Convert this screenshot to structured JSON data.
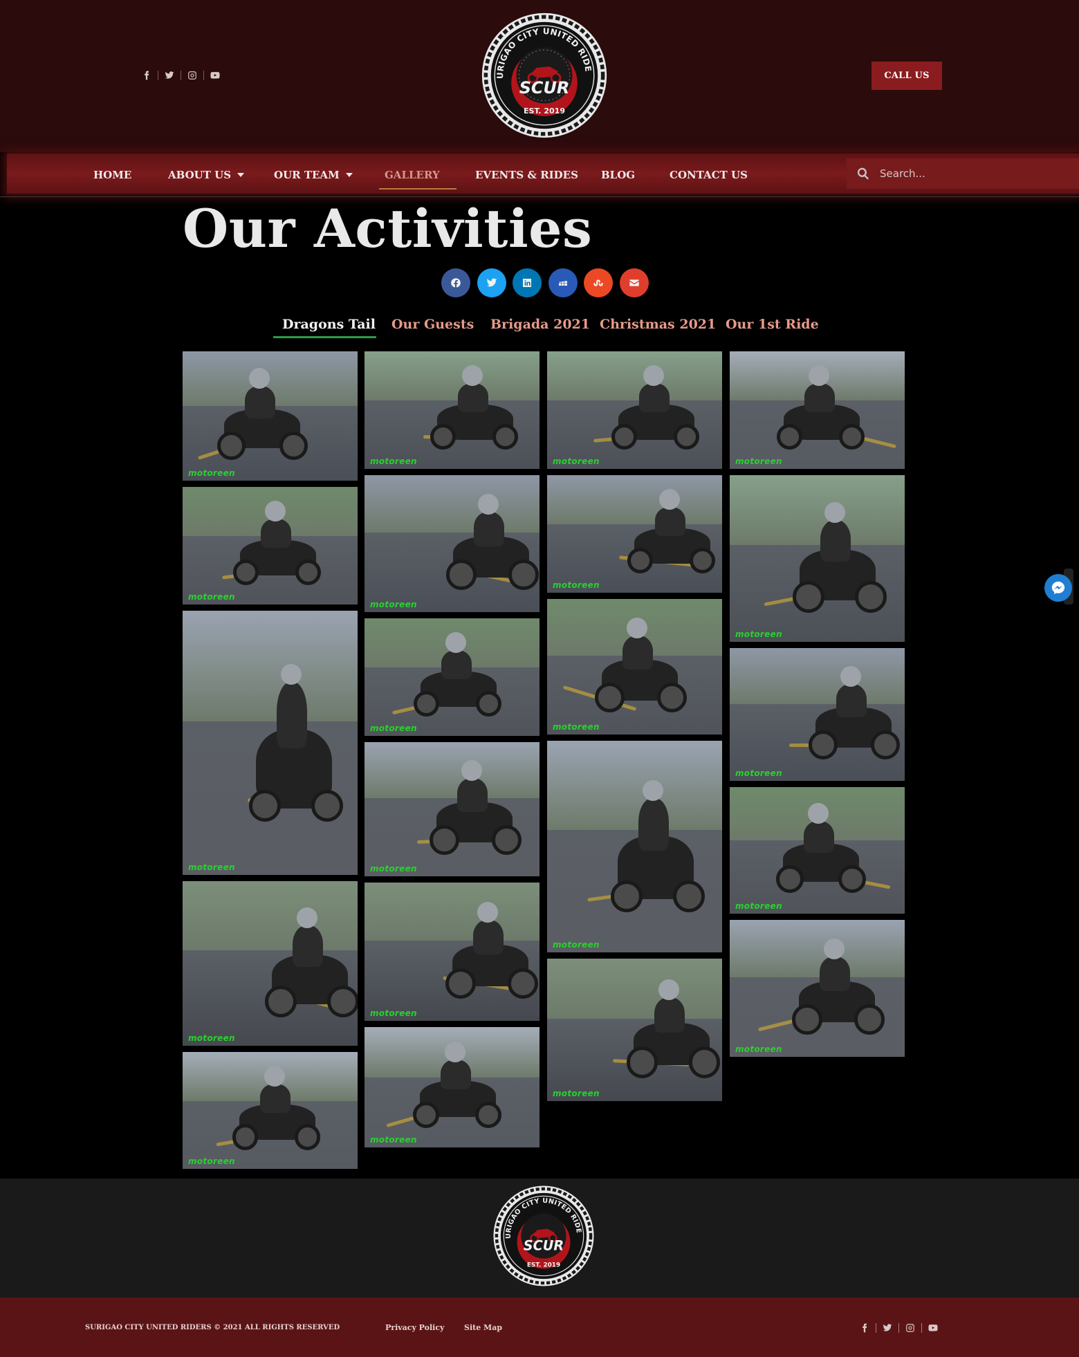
{
  "header": {
    "social_icons": [
      "facebook-icon",
      "twitter-icon",
      "instagram-icon",
      "youtube-icon"
    ],
    "logo_text": {
      "top": "SURIGAO CITY UNITED RIDERS",
      "middle": "SCUR",
      "bottom": "EST. 2019"
    },
    "call_us_label": "CALL US"
  },
  "nav": {
    "items": [
      {
        "label": "HOME",
        "has_dropdown": false,
        "active": false
      },
      {
        "label": "ABOUT US",
        "has_dropdown": true,
        "active": false
      },
      {
        "label": "OUR TEAM",
        "has_dropdown": true,
        "active": false
      },
      {
        "label": "GALLERY",
        "has_dropdown": false,
        "active": true
      },
      {
        "label": "EVENTS & RIDES",
        "has_dropdown": false,
        "active": false
      },
      {
        "label": "BLOG",
        "has_dropdown": false,
        "active": false
      },
      {
        "label": "CONTACT US",
        "has_dropdown": false,
        "active": false
      }
    ],
    "search_placeholder": "Search..."
  },
  "main": {
    "title": "Our Activities",
    "share_buttons": [
      {
        "name": "facebook-share",
        "color": "#3b5998"
      },
      {
        "name": "twitter-share",
        "color": "#1da1f2"
      },
      {
        "name": "linkedin-share",
        "color": "#0077b5"
      },
      {
        "name": "myspace-share",
        "color": "#2a5ab8"
      },
      {
        "name": "stumbleupon-share",
        "color": "#eb4924"
      },
      {
        "name": "email-share",
        "color": "#e03e2d"
      }
    ],
    "tabs": [
      {
        "label": "Dragons Tail",
        "active": true
      },
      {
        "label": "Our Guests",
        "active": false
      },
      {
        "label": "Brigada 2021",
        "active": false
      },
      {
        "label": "Christmas 2021",
        "active": false
      },
      {
        "label": "Our 1st Ride",
        "active": false
      }
    ],
    "gallery_watermark": "motoreen",
    "photo_count": 22
  },
  "footer": {
    "copyright": "SURIGAO CITY UNITED RIDERS © 2021 ALL RIGHTS RESERVED",
    "links": [
      "Privacy Policy",
      "Site Map"
    ],
    "social_icons": [
      "facebook-icon",
      "twitter-icon",
      "instagram-icon",
      "youtube-icon"
    ]
  },
  "colors": {
    "header_bg": "#2b0b0c",
    "nav_bg": "#7b1a1c",
    "accent": "#8a1c1f",
    "tab_inactive": "#e59a8a",
    "tab_underline": "#2e9a47",
    "footer_bottom_bg": "#5b1416",
    "watermark": "#29d12e"
  }
}
